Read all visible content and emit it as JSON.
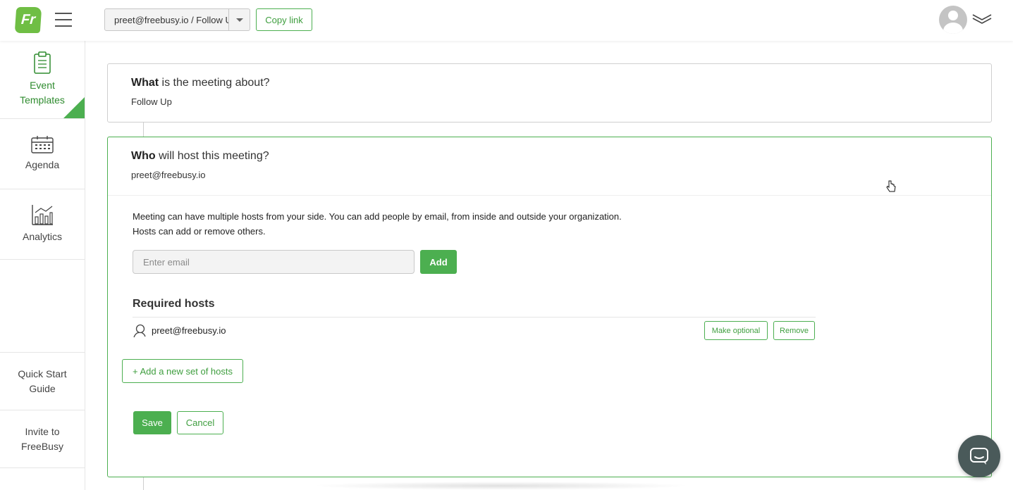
{
  "header": {
    "logo_text": "Fr",
    "booking_link_value": "preet@freebusy.io / Follow Up",
    "copy_link_label": "Copy link"
  },
  "sidebar": {
    "items": [
      {
        "label": "Event Templates",
        "icon": "clipboard-icon",
        "active": true
      },
      {
        "label": "Agenda",
        "icon": "calendar-icon",
        "active": false
      },
      {
        "label": "Analytics",
        "icon": "bar-chart-icon",
        "active": false
      },
      {
        "label": "Quick Start Guide",
        "icon": "",
        "active": false
      },
      {
        "label": "Invite to FreeBusy",
        "icon": "",
        "active": false
      }
    ]
  },
  "what_section": {
    "title_bold": "What",
    "title_rest": " is the meeting about?",
    "value": "Follow Up"
  },
  "who_section": {
    "title_bold": "Who",
    "title_rest": " will host this meeting?",
    "value": "preet@freebusy.io",
    "description": "Meeting can have multiple hosts from your side. You can add people by email, from inside and outside your organization. Hosts can add or remove others.",
    "email_placeholder": "Enter email",
    "email_value": "",
    "add_label": "Add",
    "required_hosts_title": "Required hosts",
    "hosts": [
      {
        "email": "preet@freebusy.io",
        "make_optional_label": "Make optional",
        "remove_label": "Remove"
      }
    ],
    "add_set_label": "+ Add a new set of hosts",
    "save_label": "Save",
    "cancel_label": "Cancel"
  },
  "colors": {
    "accent": "#4caf50",
    "accent_text": "#3f9e3f",
    "chat_button": "#4a5a5a"
  }
}
